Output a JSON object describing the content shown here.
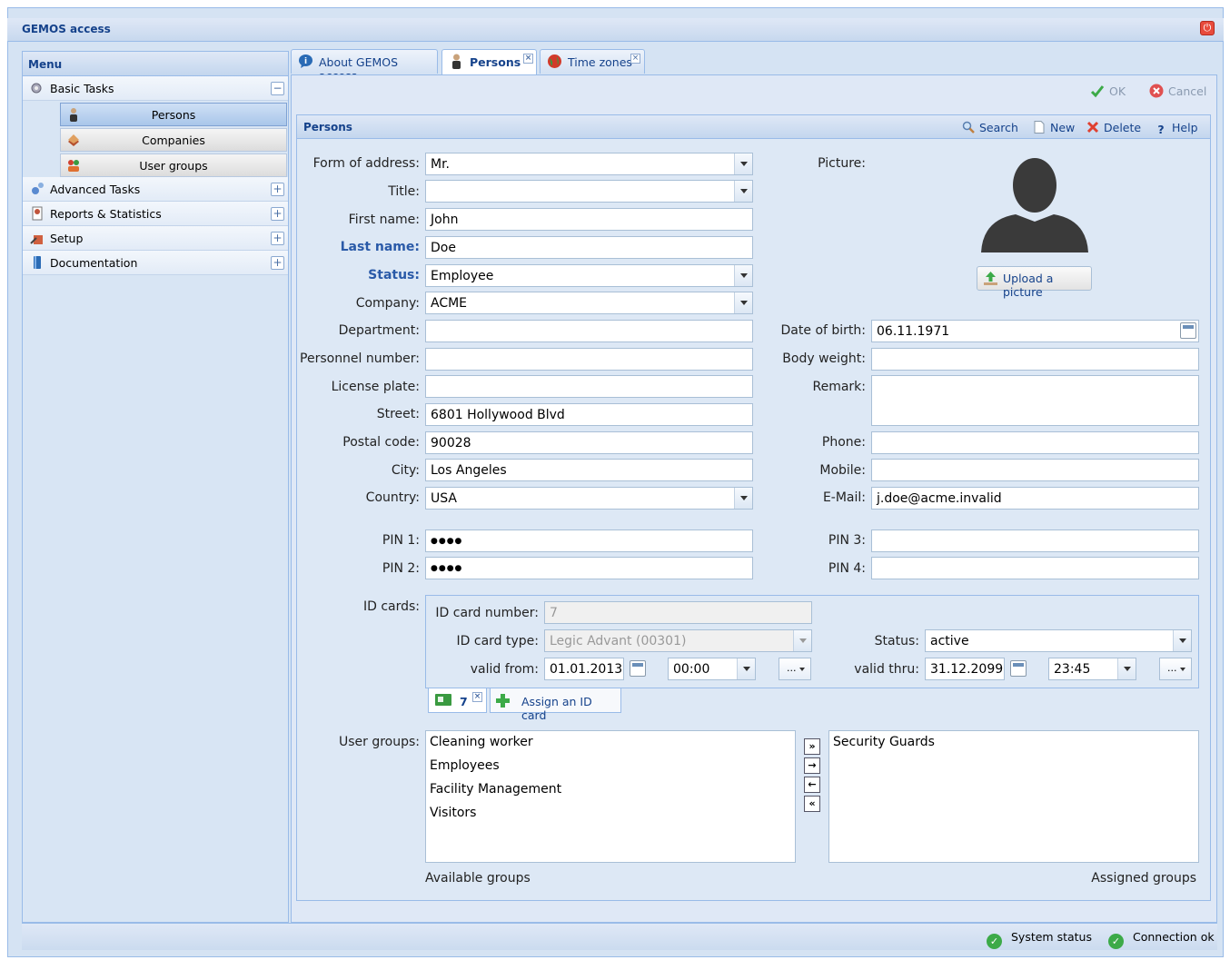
{
  "window": {
    "title": "GEMOS access"
  },
  "menu": {
    "title": "Menu",
    "sections": [
      {
        "label": "Basic Tasks",
        "expanded": true,
        "toggle": "−"
      },
      {
        "label": "Advanced Tasks",
        "toggle": "+"
      },
      {
        "label": "Reports & Statistics",
        "toggle": "+"
      },
      {
        "label": "Setup",
        "toggle": "+"
      },
      {
        "label": "Documentation",
        "toggle": "+"
      }
    ],
    "basic_items": [
      {
        "label": "Persons",
        "active": true
      },
      {
        "label": "Companies"
      },
      {
        "label": "User groups"
      }
    ]
  },
  "tabs": [
    {
      "label": "About GEMOS access"
    },
    {
      "label": "Persons",
      "active": true
    },
    {
      "label": "Time zones"
    }
  ],
  "toolbar": {
    "ok": "OK",
    "cancel": "Cancel"
  },
  "panel": {
    "title": "Persons",
    "search": "Search",
    "new": "New",
    "delete": "Delete",
    "help": "Help"
  },
  "form": {
    "form_of_address": {
      "label": "Form of address:",
      "value": "Mr."
    },
    "title": {
      "label": "Title:",
      "value": ""
    },
    "first_name": {
      "label": "First name:",
      "value": "John"
    },
    "last_name": {
      "label": "Last name:",
      "value": "Doe"
    },
    "status": {
      "label": "Status:",
      "value": "Employee"
    },
    "company": {
      "label": "Company:",
      "value": "ACME"
    },
    "department": {
      "label": "Department:",
      "value": ""
    },
    "personnel_number": {
      "label": "Personnel number:",
      "value": ""
    },
    "license_plate": {
      "label": "License plate:",
      "value": ""
    },
    "street": {
      "label": "Street:",
      "value": "6801 Hollywood Blvd"
    },
    "postal_code": {
      "label": "Postal code:",
      "value": "90028"
    },
    "city": {
      "label": "City:",
      "value": "Los Angeles"
    },
    "country": {
      "label": "Country:",
      "value": "USA"
    },
    "pin1": {
      "label": "PIN 1:",
      "value": "●●●●"
    },
    "pin2": {
      "label": "PIN 2:",
      "value": "●●●●"
    },
    "picture": {
      "label": "Picture:",
      "upload": "Upload a picture"
    },
    "dob": {
      "label": "Date of birth:",
      "value": "06.11.1971"
    },
    "body_weight": {
      "label": "Body weight:",
      "value": ""
    },
    "remark": {
      "label": "Remark:",
      "value": ""
    },
    "phone": {
      "label": "Phone:",
      "value": ""
    },
    "mobile": {
      "label": "Mobile:",
      "value": ""
    },
    "email": {
      "label": "E-Mail:",
      "value": "j.doe@acme.invalid"
    },
    "pin3": {
      "label": "PIN 3:",
      "value": ""
    },
    "pin4": {
      "label": "PIN 4:",
      "value": ""
    }
  },
  "id_cards": {
    "label": "ID cards:",
    "number_label": "ID card number:",
    "number": "7",
    "type_label": "ID card type:",
    "type": "Legic Advant (00301)",
    "status_label": "Status:",
    "status": "active",
    "from_label": "valid from:",
    "from_date": "01.01.2013",
    "from_time": "00:00",
    "thru_label": "valid thru:",
    "thru_date": "31.12.2099",
    "thru_time": "23:45",
    "more": "...",
    "card_tab": "7",
    "assign": "Assign an ID card"
  },
  "user_groups": {
    "label": "User groups:",
    "available": [
      "Cleaning worker",
      "Employees",
      "Facility Management",
      "Visitors"
    ],
    "assigned": [
      "Security Guards"
    ],
    "available_caption": "Available groups",
    "assigned_caption": "Assigned groups"
  },
  "statusbar": {
    "system": "System status",
    "connection": "Connection ok"
  }
}
